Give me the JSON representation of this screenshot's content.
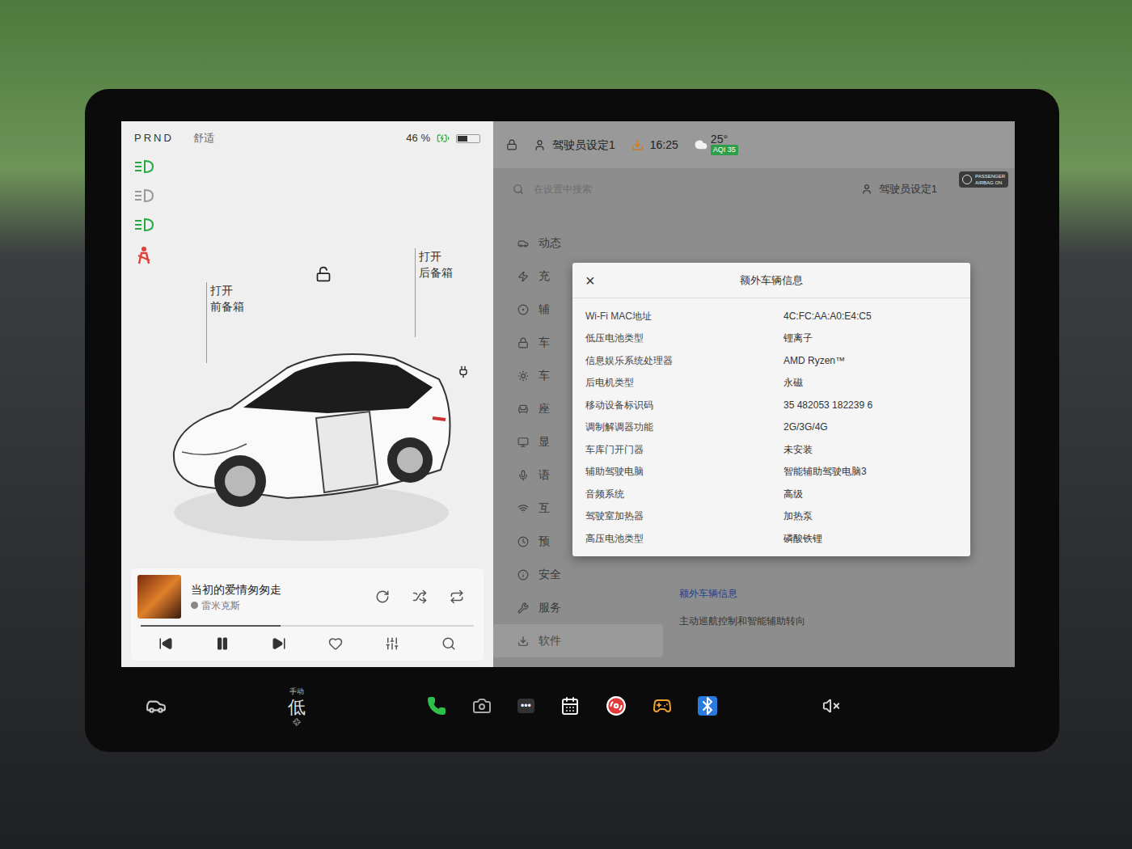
{
  "status": {
    "gear": "PRND",
    "mode": "舒适",
    "battery": "46 %",
    "battery_level": 0.46,
    "charging": true
  },
  "car": {
    "frunk": {
      "action": "打开",
      "label": "前备箱"
    },
    "trunk": {
      "action": "打开",
      "label": "后备箱"
    },
    "locked": false
  },
  "media": {
    "title": "当初的爱情匆匆走",
    "artist": "雷米克斯",
    "progress": 0.42,
    "playing": true,
    "liked": false
  },
  "top_bar": {
    "profile": "驾驶员设定1",
    "time": "16:25",
    "temperature": "25°",
    "aqi": "AQI 35"
  },
  "settings": {
    "search_placeholder": "在设置中搜索",
    "profile": "驾驶员设定1",
    "menu": [
      {
        "label": "动态",
        "selected": false
      },
      {
        "label": "充",
        "selected": false
      },
      {
        "label": "辅",
        "selected": false
      },
      {
        "label": "车",
        "selected": false
      },
      {
        "label": "车",
        "selected": false
      },
      {
        "label": "座",
        "selected": false
      },
      {
        "label": "显",
        "selected": false
      },
      {
        "label": "语",
        "selected": false
      },
      {
        "label": "互",
        "selected": false
      },
      {
        "label": "预",
        "selected": false
      },
      {
        "label": "安全",
        "selected": false
      },
      {
        "label": "服务",
        "selected": false
      },
      {
        "label": "软件",
        "selected": true
      }
    ],
    "link": "额外车辆信息",
    "option": "主动巡航控制和智能辅助转向"
  },
  "dialog": {
    "title": "额外车辆信息",
    "close": "×",
    "rows": [
      {
        "label": "Wi-Fi MAC地址",
        "value": "4C:FC:AA:A0:E4:C5"
      },
      {
        "label": "低压电池类型",
        "value": "锂离子"
      },
      {
        "label": "信息娱乐系统处理器",
        "value": "AMD Ryzen™"
      },
      {
        "label": "后电机类型",
        "value": "永磁"
      },
      {
        "label": "移动设备标识码",
        "value": "35 482053 182239 6"
      },
      {
        "label": "调制解调器功能",
        "value": "2G/3G/4G"
      },
      {
        "label": "车库门开门器",
        "value": "未安装"
      },
      {
        "label": "辅助驾驶电脑",
        "value": "智能辅助驾驶电脑3"
      },
      {
        "label": "音频系统",
        "value": "高级"
      },
      {
        "label": "驾驶室加热器",
        "value": "加热泵"
      },
      {
        "label": "高压电池类型",
        "value": "磷酸铁锂"
      }
    ]
  },
  "airbag": {
    "line1": "PASSENGER",
    "line2": "AIRBAG ON"
  },
  "bottom_bar": {
    "climate_mode": "手动",
    "fan": "低",
    "more": "•••",
    "muted": true
  }
}
